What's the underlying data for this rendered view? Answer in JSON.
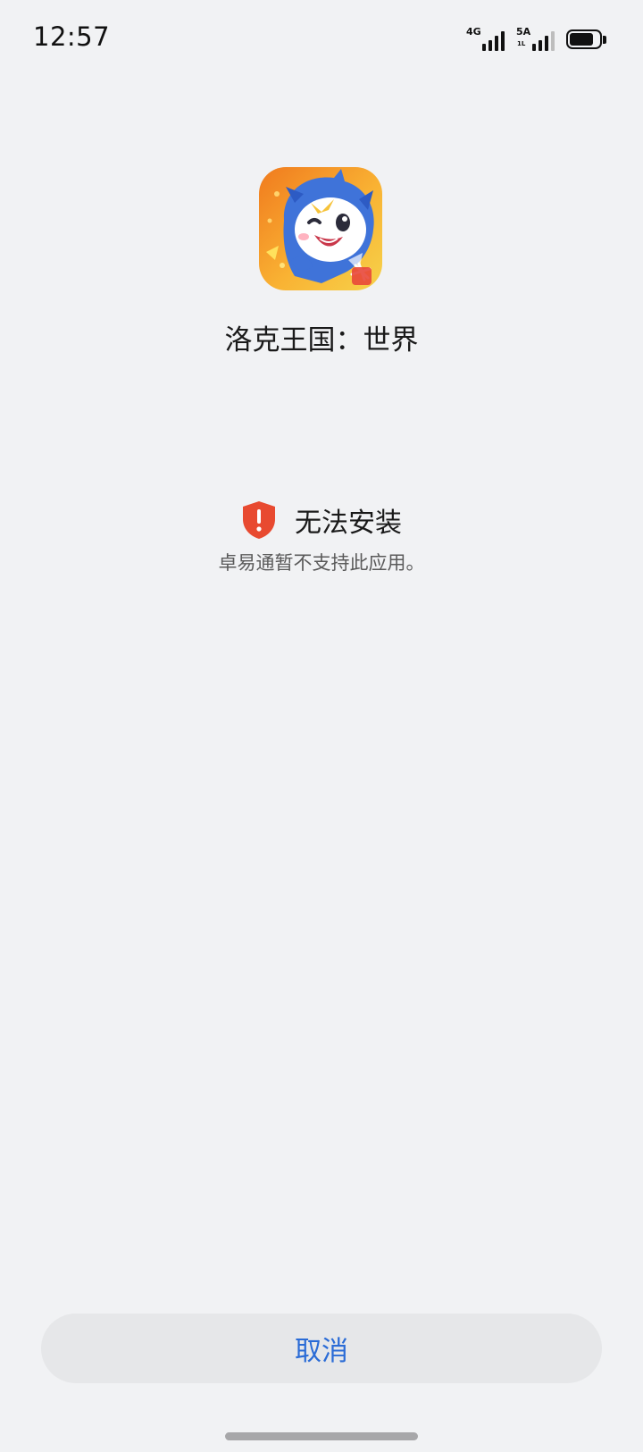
{
  "status_bar": {
    "time": "12:57",
    "sim1_label": "4G",
    "sim2_label": "5A",
    "sim2_sub": "1L",
    "battery_level": 0.8
  },
  "app": {
    "name": "洛克王国：世界"
  },
  "error": {
    "title": "无法安装",
    "description": "卓易通暂不支持此应用。"
  },
  "buttons": {
    "cancel_label": "取消"
  },
  "colors": {
    "accent": "#2a6bd6",
    "error_red": "#e84a30",
    "background": "#f1f2f4"
  }
}
